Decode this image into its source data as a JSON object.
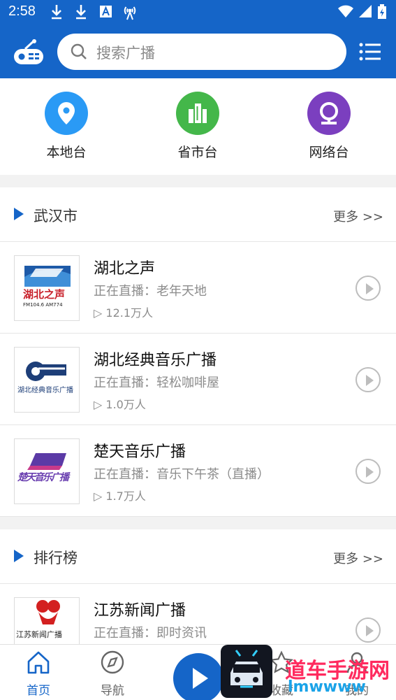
{
  "status_bar": {
    "time": "2:58"
  },
  "search": {
    "placeholder": "搜索广播"
  },
  "categories": [
    {
      "label": "本地台",
      "icon": "location-pin-icon",
      "color": "#2a9af5"
    },
    {
      "label": "省市台",
      "icon": "building-icon",
      "color": "#44b74a"
    },
    {
      "label": "网络台",
      "icon": "globe-icon",
      "color": "#7b3fbf"
    }
  ],
  "sections": [
    {
      "title": "武汉市",
      "more": "更多 >>",
      "items": [
        {
          "name": "湖北之声",
          "live": "正在直播：老年天地",
          "count": "▷ 12.1万人",
          "logo_text": "湖北之声",
          "logo_sub": "FM104.6 AM774"
        },
        {
          "name": "湖北经典音乐广播",
          "live": "正在直播：轻松咖啡屋",
          "count": "▷ 1.0万人",
          "logo_text": "湖北经典音乐广播"
        },
        {
          "name": "楚天音乐广播",
          "live": "正在直播：音乐下午茶（直播）",
          "count": "▷ 1.7万人",
          "logo_text": "楚天音乐广播"
        }
      ]
    },
    {
      "title": "排行榜",
      "more": "更多 >>",
      "items": [
        {
          "name": "江苏新闻广播",
          "live": "正在直播：即时资讯",
          "logo_text": "江苏新闻广播"
        }
      ]
    }
  ],
  "tabbar": {
    "items": [
      {
        "label": "首页",
        "icon": "home-icon"
      },
      {
        "label": "导航",
        "icon": "compass-icon"
      },
      {
        "label": "收藏",
        "icon": "star-icon"
      },
      {
        "label": "我的",
        "icon": "user-icon"
      }
    ]
  },
  "watermark": {
    "text": "道车手游网",
    "url": "lmwwww"
  },
  "colors": {
    "primary": "#1565c8"
  }
}
